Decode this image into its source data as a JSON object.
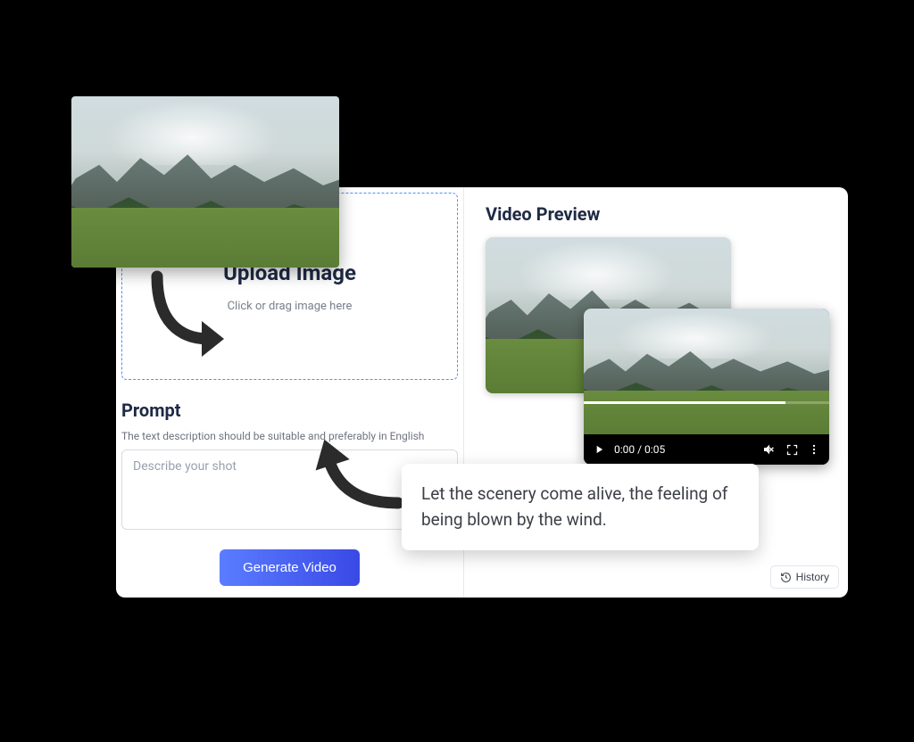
{
  "upload": {
    "title": "Upload Image",
    "subtitle": "Click or drag image here"
  },
  "prompt": {
    "title": "Prompt",
    "help": "The text description should be suitable and preferably in English",
    "placeholder": "Describe your shot"
  },
  "generate_label": "Generate Video",
  "preview": {
    "title": "Video Preview",
    "time": "0:00 / 0:05"
  },
  "history_label": "History",
  "callout_text": "Let the scenery come alive, the feeling of being blown by the wind."
}
